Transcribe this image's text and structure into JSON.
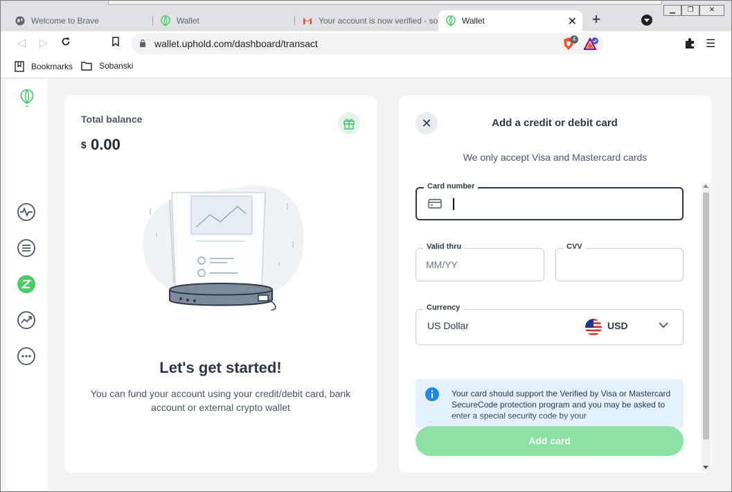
{
  "browser": {
    "tabs": [
      {
        "title": "Welcome to Brave",
        "icon": "globe-icon"
      },
      {
        "title": "Wallet",
        "icon": "uphold-logo-icon"
      },
      {
        "title": "Your account is now verified - soba",
        "icon": "gmail-icon"
      },
      {
        "title": "Wallet",
        "icon": "uphold-logo-icon",
        "active": true
      }
    ],
    "url": "wallet.uphold.com/dashboard/transact",
    "brave_shield_count": "4",
    "bookmarks": [
      {
        "label": "Bookmarks",
        "icon": "bookmark-icon"
      },
      {
        "label": "Sobanski",
        "icon": "folder-icon"
      }
    ]
  },
  "sidebar": {
    "items": [
      "activity-icon",
      "list-icon",
      "transact-icon",
      "trends-icon",
      "more-icon"
    ]
  },
  "balance": {
    "label": "Total balance",
    "currency_symbol": "$",
    "amount": "0.00",
    "title": "Let's get started!",
    "description": "You can fund your account using your credit/debit card, bank account or external crypto wallet"
  },
  "card_form": {
    "title": "Add a credit or debit card",
    "subtitle": "We only accept Visa and Mastercard cards",
    "card_number_label": "Card number",
    "valid_thru_label": "Valid thru",
    "valid_thru_placeholder": "MM/YY",
    "cvv_label": "CVV",
    "currency_label": "Currency",
    "currency_name": "US Dollar",
    "currency_code": "USD",
    "notice": "Your card should support the Verified by Visa or Mastercard SecureCode protection program and you may be asked to enter a special security code by your",
    "submit_label": "Add card"
  },
  "colors": {
    "accent_green": "#49cc68",
    "button_disabled": "#8be0a4",
    "info_blue": "#1e88e5"
  }
}
